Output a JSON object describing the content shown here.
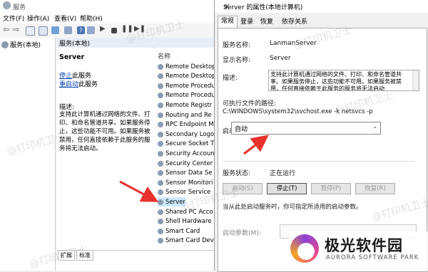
{
  "main_window": {
    "title": "服务",
    "menu": [
      "文件(F)",
      "操作(A)",
      "查看(V)",
      "帮助(H)"
    ],
    "tree_item": "服务(本地)",
    "pane_header": "服务(本地)",
    "selected_service": "Server",
    "stop_link": "停止",
    "stop_suffix": "此服务",
    "restart_link": "重启动",
    "restart_suffix": "此服务",
    "desc_label": "描述:",
    "desc_text": "支持此计算机通过网络的文件、打印、和命名管道共享。如果服务停止，这些功能不可用。如果服务被禁用，任何直接依赖于此服务的服务将无法启动。",
    "list_header": "名称",
    "services": [
      "Remote Desktop",
      "Remote Desktop",
      "Remote Procedu",
      "Remote Procedu",
      "Remote Registr",
      "Routing and Re",
      "RPC Endpoint M",
      "Secondary Logo",
      "Secure Socket T",
      "Security Accoun",
      "Security Center",
      "Sensor Data Se",
      "Sensor Monitori",
      "Sensor Service",
      "Server",
      "Shared PC Acco",
      "Shell Hardware",
      "Smart Card",
      "Smart Card Dev"
    ],
    "selected_index": 14,
    "bottom_tabs": [
      "扩展",
      "标准"
    ]
  },
  "dialog": {
    "title": "Server 的属性(本地计算机)",
    "close": "✕",
    "tabs": [
      "常规",
      "登录",
      "恢复",
      "依存关系"
    ],
    "service_name_label": "服务名称:",
    "service_name": "LanmanServer",
    "display_name_label": "显示名称:",
    "display_name": "Server",
    "description_label": "描述:",
    "description": "支持此计算机通过网络的文件、打印、和命名管道共享。如果服务停止，这些功能不可用。如果服务被禁用，任何直接依赖于此服务的服务将无法启动",
    "exe_path_label": "可执行文件的路径:",
    "exe_path": "C:\\WINDOWS\\system32\\svchost.exe -k netsvcs -p",
    "startup_type_label": "启动类型(E):",
    "startup_type": "自动",
    "status_label": "服务状态:",
    "status": "正在运行",
    "buttons": [
      "启动(S)",
      "停止(T)",
      "暂停(P)",
      "恢复(R)"
    ],
    "button_enabled": [
      false,
      true,
      false,
      false
    ],
    "hint": "当从此处启动服务时，你可指定所适用的启动参数。",
    "params_label": "启动参数(M):"
  },
  "watermark": "@打印机卫士",
  "logo": {
    "name": "极光软件园",
    "sub": "AURORA SOFTWARE PARK"
  },
  "colors": {
    "selection": "#cce8ff",
    "arrow": "#e8322e",
    "link": "#0645ad"
  }
}
